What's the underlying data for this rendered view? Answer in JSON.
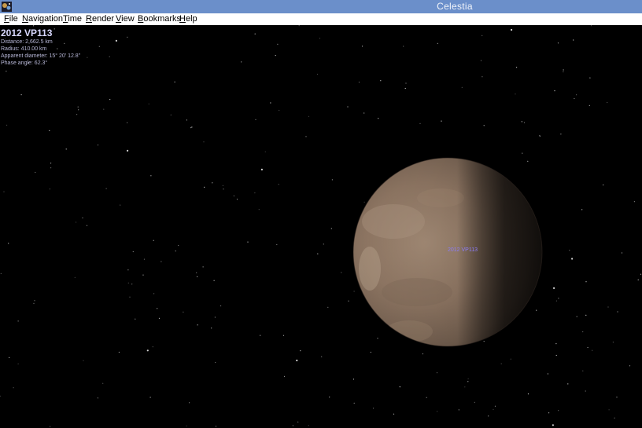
{
  "window": {
    "title": "Celestia",
    "icon": "celestia-app-icon"
  },
  "menubar": {
    "items": [
      {
        "label": "File",
        "key": "F",
        "rest": "ile"
      },
      {
        "label": "Navigation",
        "key": "N",
        "rest": "avigation"
      },
      {
        "label": "Time",
        "key": "T",
        "rest": "ime"
      },
      {
        "label": "Render",
        "key": "R",
        "rest": "ender"
      },
      {
        "label": "View",
        "key": "V",
        "rest": "iew"
      },
      {
        "label": "Bookmarks",
        "key": "B",
        "rest": "ookmarks"
      },
      {
        "label": "Help",
        "key": "H",
        "rest": "elp"
      }
    ]
  },
  "hud": {
    "object_name": "2012 VP113",
    "distance": "Distance: 2,662.5 km",
    "radius": "Radius: 410.00 km",
    "apparent_diameter": "Apparent diameter: 15° 20' 12.8\"",
    "phase_angle": "Phase angle: 62.3°"
  },
  "scene": {
    "planet_label": "2012 VP113",
    "label_color": "#8b7cf6",
    "planet_color": "#8a7260",
    "background_color": "#000000"
  }
}
